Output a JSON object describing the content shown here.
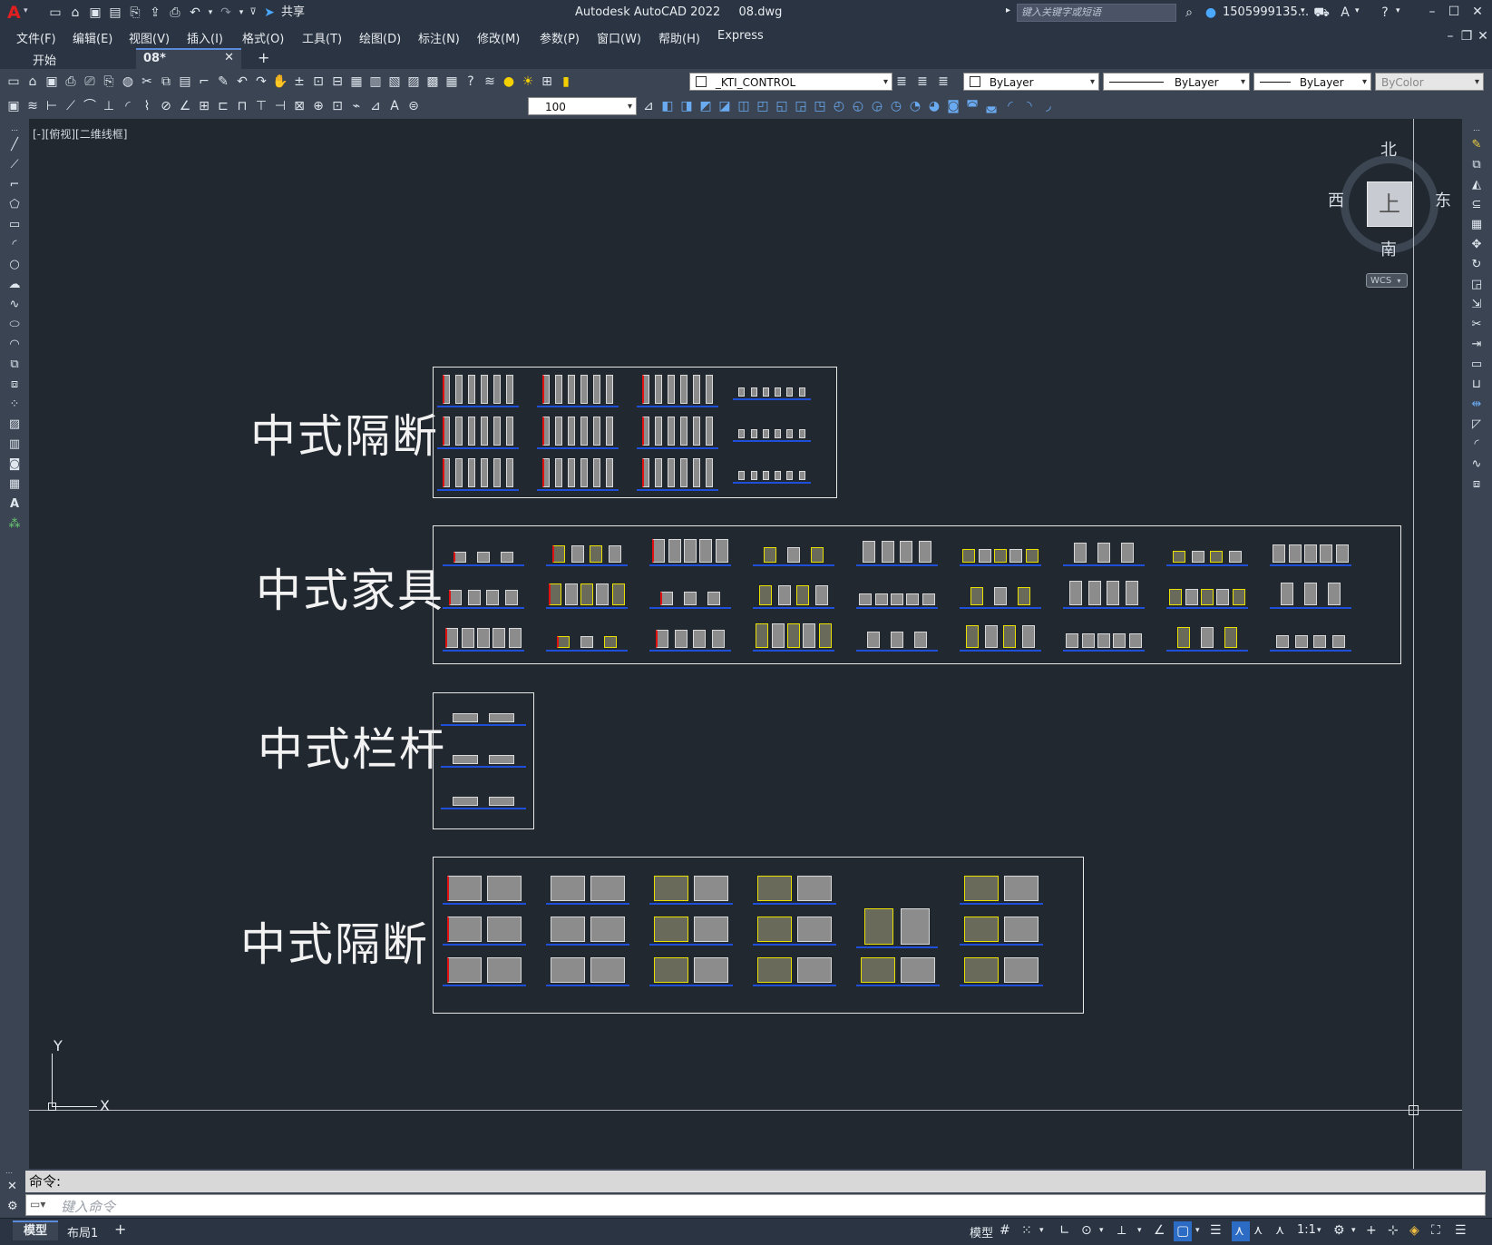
{
  "app": {
    "logo": "A",
    "title": "Autodesk AutoCAD 2022",
    "filename": "08.dwg",
    "search_placeholder": "键入关键字或短语",
    "user": "1505999135...",
    "share_label": "共享"
  },
  "menu": [
    "文件(F)",
    "编辑(E)",
    "视图(V)",
    "插入(I)",
    "格式(O)",
    "工具(T)",
    "绘图(D)",
    "标注(N)",
    "修改(M)",
    "参数(P)",
    "窗口(W)",
    "帮助(H)",
    "Express"
  ],
  "tabs": [
    {
      "label": "开始",
      "active": false
    },
    {
      "label": "08*",
      "active": true
    }
  ],
  "toolbar": {
    "layer_name": "_KTI_CONTROL",
    "color": "ByLayer",
    "linetype": "ByLayer",
    "lineweight": "ByLayer",
    "plotstyle": "ByColor",
    "dimscale": "100"
  },
  "viewport": {
    "label": "[-][俯视][二维线框]"
  },
  "viewcube": {
    "north": "北",
    "south": "南",
    "east": "东",
    "west": "西",
    "top": "上",
    "wcs": "WCS"
  },
  "ucs": {
    "x": "X",
    "y": "Y"
  },
  "drawing": {
    "groups": [
      {
        "caption": "中式隔断"
      },
      {
        "caption": "中式家具"
      },
      {
        "caption": "中式栏杆"
      },
      {
        "caption": "中式隔断"
      }
    ]
  },
  "command": {
    "history": "命令:",
    "placeholder": "键入命令"
  },
  "layout_tabs": [
    "模型",
    "布局1"
  ],
  "status": {
    "model": "模型",
    "scale": "1:1"
  },
  "colors": {
    "background": "#212830",
    "ribbon": "#3b4453",
    "titlebar": "#2b3442",
    "baseline": "#1f4fd8",
    "highlight_yellow": "#e8e000",
    "accent_red": "#e01010"
  }
}
